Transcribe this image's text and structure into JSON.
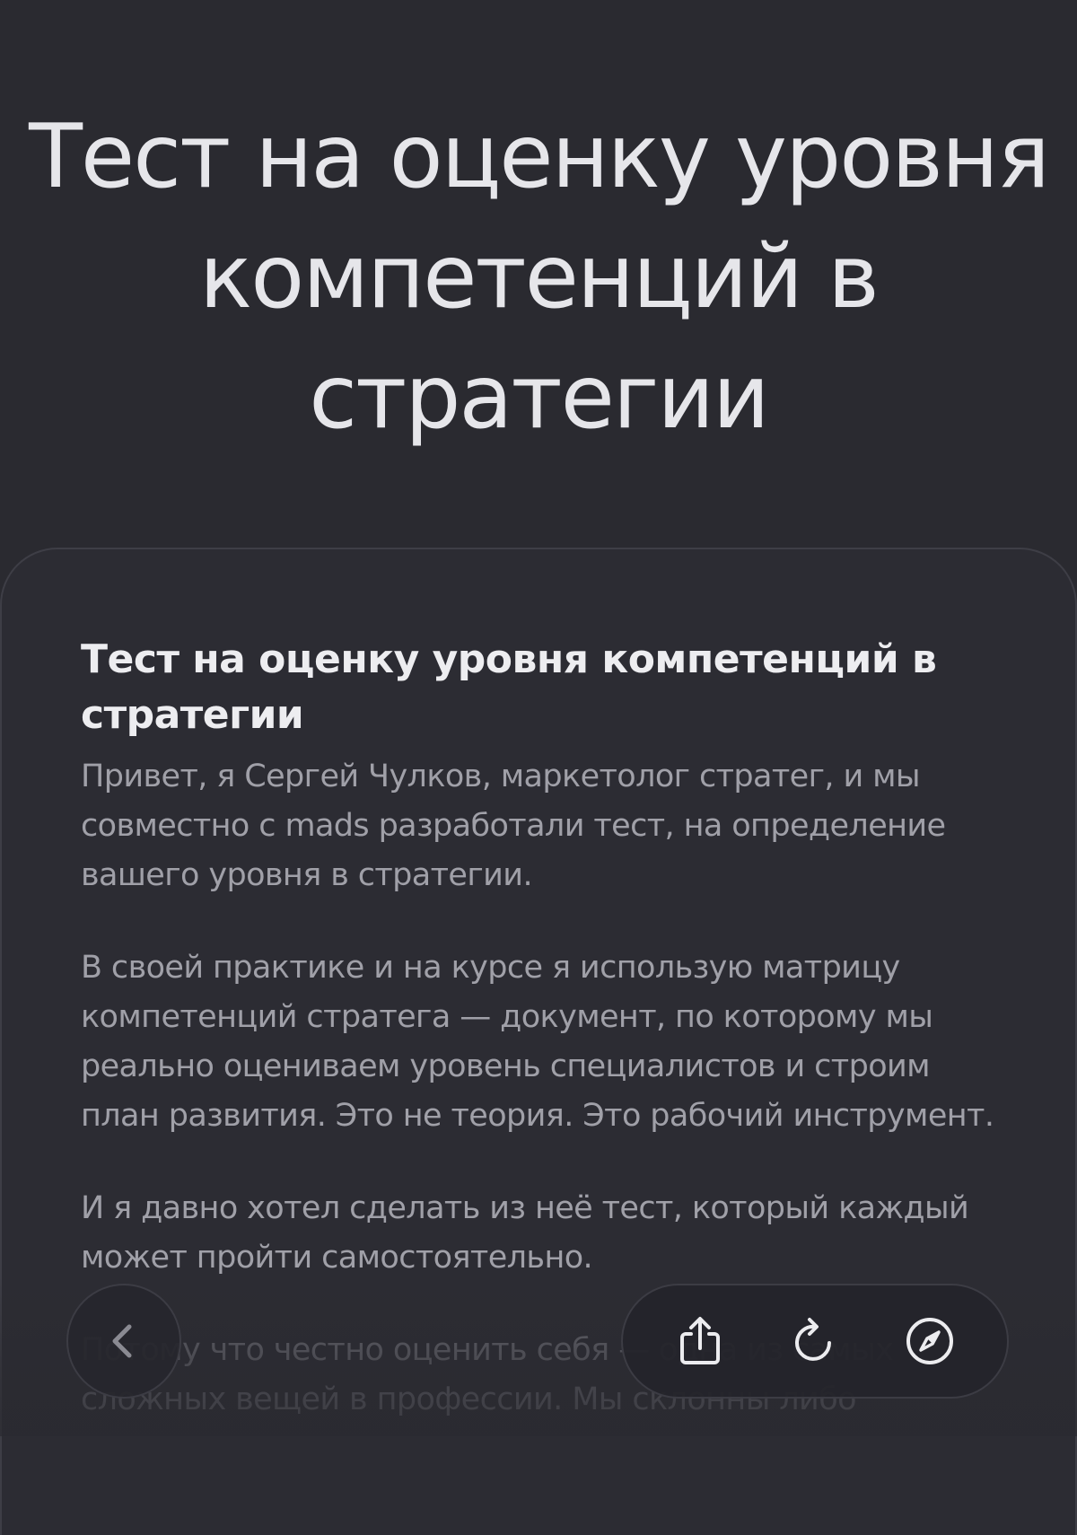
{
  "hero": {
    "title": "Тест на оценку уровня компетенций в стратегии"
  },
  "card": {
    "title": "Тест на оценку уровня компетенций в стратегии",
    "paragraphs": [
      "Привет, я Сергей Чулков, маркетолог стратег, и мы совместно с mads разработали тест, на определение вашего уровня в стратегии.",
      "В своей практике и на курсе я использую матрицу компетенций стратега — документ, по которому мы реально оцениваем уровень специалистов и строим план развития. Это не теория. Это рабочий инструмент.",
      "И я давно хотел сделать из неё тест, который каждый может пройти самостоятельно.",
      "Потому что честно оценить себя — одна из самых сложных вещей в профессии. Мы склонны либо"
    ]
  },
  "nav": {
    "back_icon": "chevron-left-icon",
    "share_icon": "share-icon",
    "reload_icon": "reload-icon",
    "compass_icon": "compass-icon"
  },
  "colors": {
    "background": "#2a2a30",
    "card": "#2c2c33",
    "title_text": "#e6e6ea",
    "body_text": "#a0a0a8"
  }
}
